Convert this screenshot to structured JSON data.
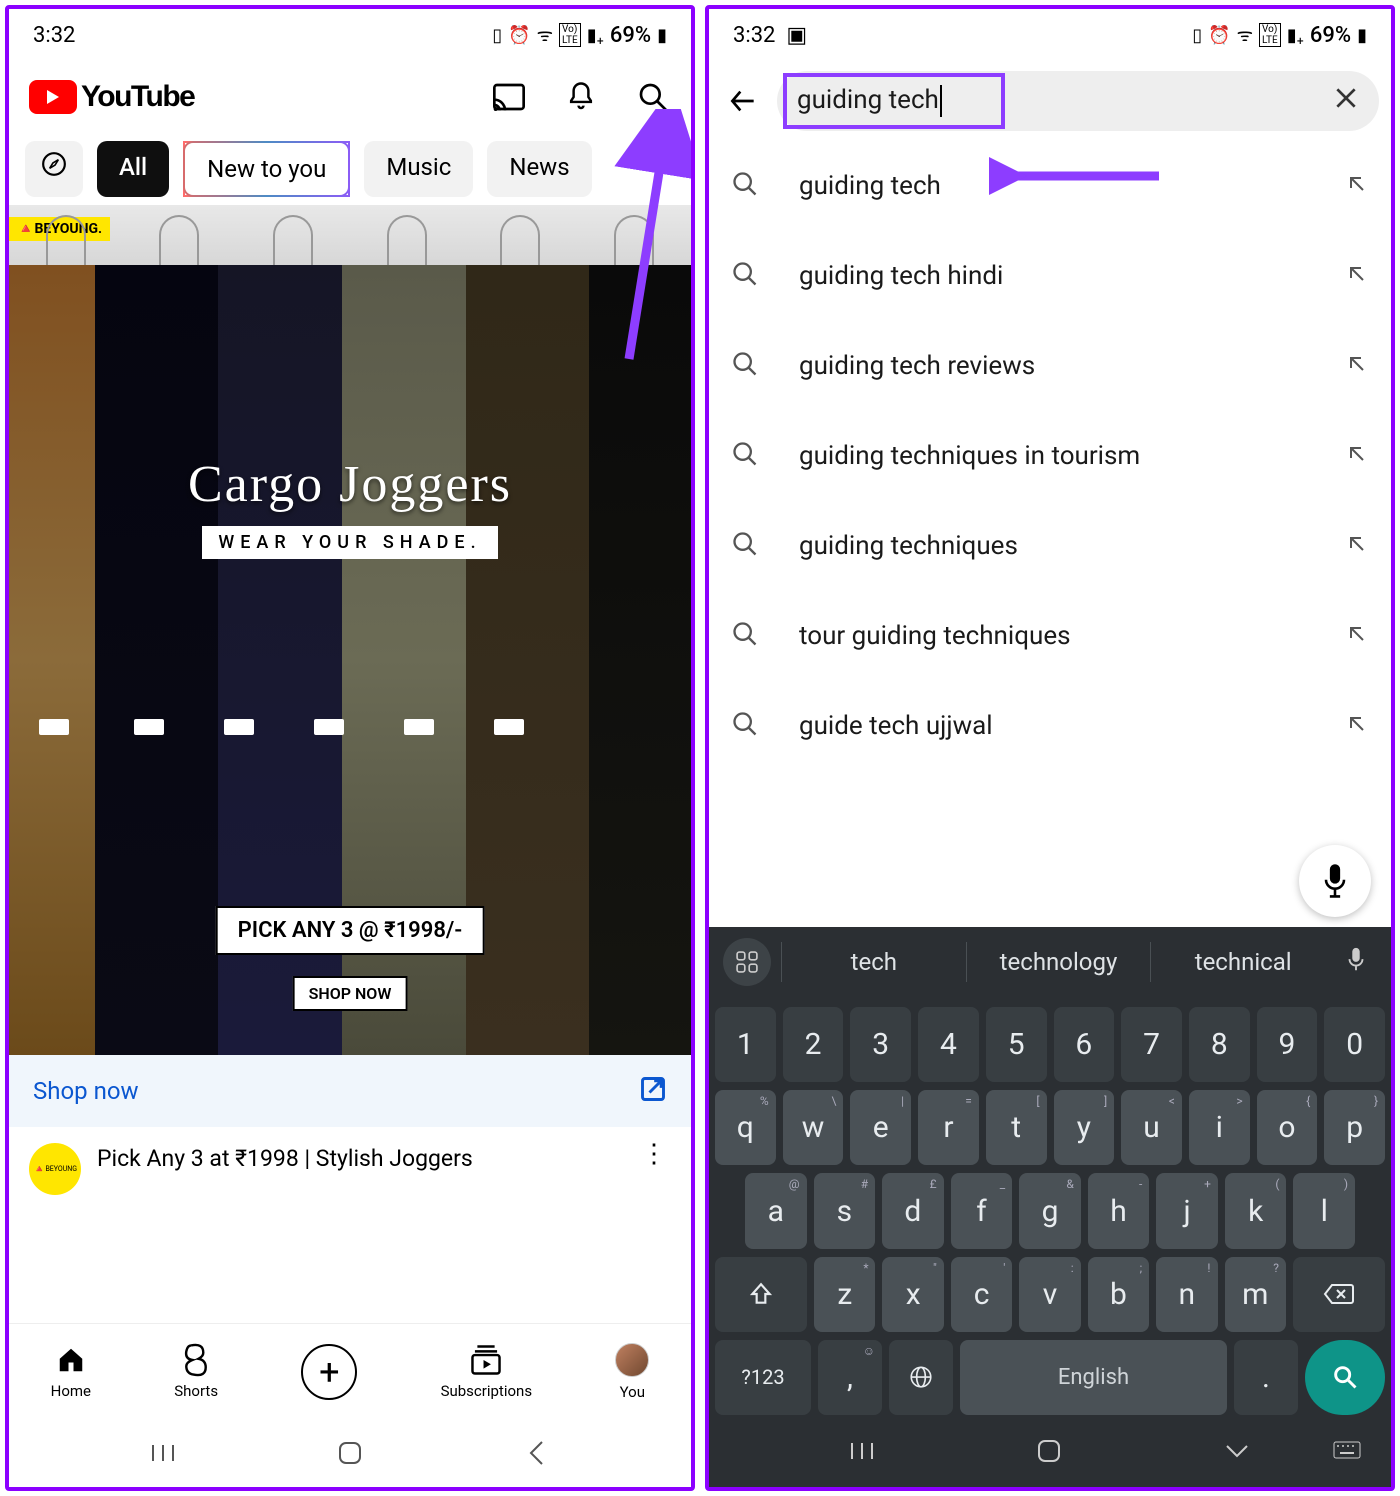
{
  "status": {
    "time": "3:32",
    "battery": "69%",
    "icons": [
      "card",
      "alarm",
      "wifi",
      "volte",
      "signal",
      "battery"
    ]
  },
  "youtube": {
    "brand": "YouTube",
    "chips": {
      "all": "All",
      "new": "New to you",
      "music": "Music",
      "news": "News"
    },
    "ad": {
      "tag": "BEYOUNG.",
      "title": "Cargo Joggers",
      "subtitle": "WEAR YOUR SHADE.",
      "price": "PICK ANY 3 @ ₹1998/-",
      "cta": "SHOP NOW",
      "shop_link": "Shop now",
      "video_title": "Pick Any 3 at ₹1998 | Stylish Joggers",
      "brand_short": "BEYOUNG"
    },
    "nav": {
      "home": "Home",
      "shorts": "Shorts",
      "subs": "Subscriptions",
      "you": "You"
    }
  },
  "search": {
    "query": "guiding tech",
    "suggestions": [
      "guiding tech",
      "guiding tech hindi",
      "guiding tech reviews",
      "guiding techniques in tourism",
      "guiding techniques",
      "tour guiding techniques",
      "guide tech ujjwal"
    ]
  },
  "keyboard": {
    "predictions": [
      "tech",
      "technology",
      "technical"
    ],
    "row1": [
      "1",
      "2",
      "3",
      "4",
      "5",
      "6",
      "7",
      "8",
      "9",
      "0"
    ],
    "row2": [
      "q",
      "w",
      "e",
      "r",
      "t",
      "y",
      "u",
      "i",
      "o",
      "p"
    ],
    "row2_sup": [
      "%",
      "\\",
      "|",
      "=",
      "[",
      "]",
      "<",
      ">",
      "{",
      "}"
    ],
    "row3": [
      "a",
      "s",
      "d",
      "f",
      "g",
      "h",
      "j",
      "k",
      "l"
    ],
    "row3_sup": [
      "@",
      "#",
      "£",
      "_",
      "&",
      "-",
      "+",
      "(",
      ")"
    ],
    "row4": [
      "z",
      "x",
      "c",
      "v",
      "b",
      "n",
      "m"
    ],
    "row4_sup": [
      "*",
      "\"",
      "'",
      ":",
      ";",
      "!",
      "?"
    ],
    "symkey": "?123",
    "space": "English"
  }
}
